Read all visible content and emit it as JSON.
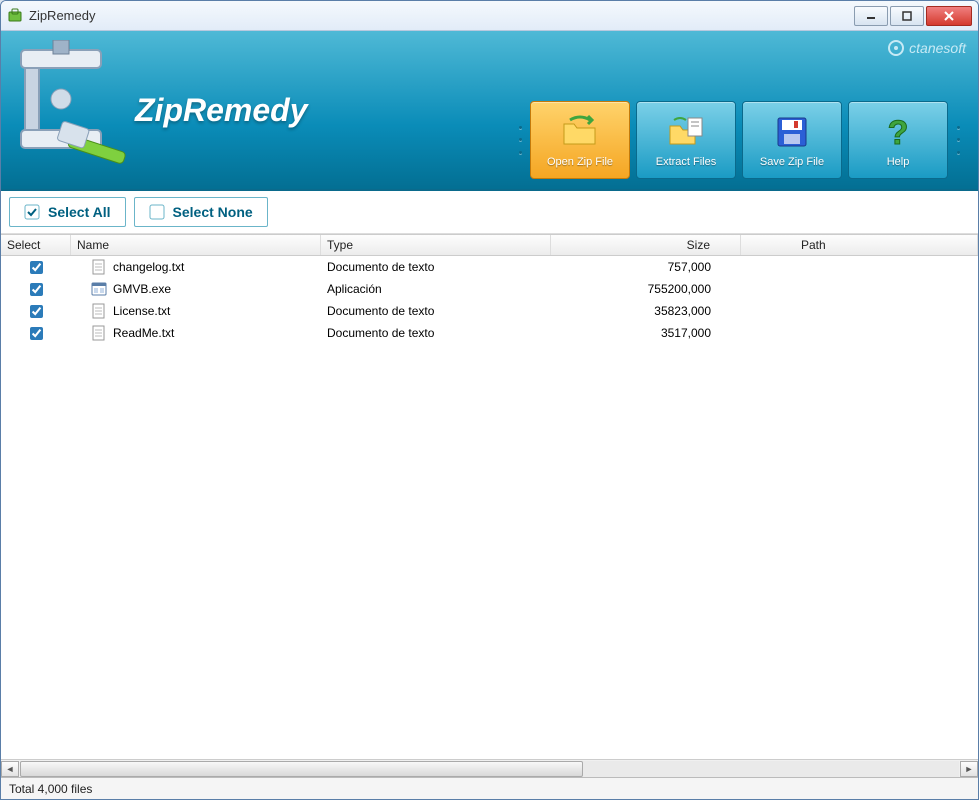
{
  "window": {
    "title": "ZipRemedy"
  },
  "banner": {
    "title": "ZipRemedy",
    "company": "ctanesoft",
    "buttons": [
      {
        "label": "Open Zip File",
        "icon": "open-folder-icon",
        "active": true
      },
      {
        "label": "Extract Files",
        "icon": "extract-icon",
        "active": false
      },
      {
        "label": "Save Zip File",
        "icon": "save-icon",
        "active": false
      },
      {
        "label": "Help",
        "icon": "help-icon",
        "active": false
      }
    ]
  },
  "toolbar": {
    "select_all": "Select All",
    "select_none": "Select None"
  },
  "columns": {
    "select": "Select",
    "name": "Name",
    "type": "Type",
    "size": "Size",
    "path": "Path"
  },
  "files": [
    {
      "name": "changelog.txt",
      "type": "Documento de texto",
      "size": "757,000",
      "path": "",
      "icon": "text",
      "checked": true
    },
    {
      "name": "GMVB.exe",
      "type": "Aplicación",
      "size": "755200,000",
      "path": "",
      "icon": "exe",
      "checked": true
    },
    {
      "name": "License.txt",
      "type": "Documento de texto",
      "size": "35823,000",
      "path": "",
      "icon": "text",
      "checked": true
    },
    {
      "name": "ReadMe.txt",
      "type": "Documento de texto",
      "size": "3517,000",
      "path": "",
      "icon": "text",
      "checked": true
    }
  ],
  "status": "Total 4,000 files"
}
